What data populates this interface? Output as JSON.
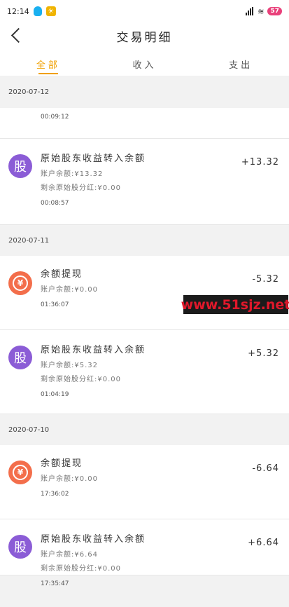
{
  "status": {
    "time": "12:14",
    "battery": "57"
  },
  "header": {
    "title": "交易明细"
  },
  "tabs": [
    {
      "label": "全部"
    },
    {
      "label": "收入"
    },
    {
      "label": "支出"
    }
  ],
  "groups": [
    {
      "date": "2020-07-12"
    },
    {
      "date": "2020-07-11"
    },
    {
      "date": "2020-07-10"
    }
  ],
  "records": [
    {
      "time": "00:09:12"
    },
    {
      "icon": "股",
      "title": "原始股东收益转入余额",
      "line1": "账户余额:¥13.32",
      "line2": "剩余原始股分红:¥0.00",
      "time": "00:08:57",
      "amount": "+13.32"
    },
    {
      "icon": "¥",
      "title": "余额提现",
      "line1": "账户余额:¥0.00",
      "time": "01:36:07",
      "amount": "-5.32"
    },
    {
      "icon": "股",
      "title": "原始股东收益转入余额",
      "line1": "账户余额:¥5.32",
      "line2": "剩余原始股分红:¥0.00",
      "time": "01:04:19",
      "amount": "+5.32"
    },
    {
      "icon": "¥",
      "title": "余额提现",
      "line1": "账户余额:¥0.00",
      "time": "17:36:02",
      "amount": "-6.64"
    },
    {
      "icon": "股",
      "title": "原始股东收益转入余额",
      "line1": "账户余额:¥6.64",
      "line2": "剩余原始股分红:¥0.00",
      "time": "17:35:47",
      "amount": "+6.64"
    }
  ],
  "watermark": "www.51sjz.net",
  "colors": {
    "accent": "#f0a000",
    "stock_icon": "#8b5cd6",
    "cash_icon": "#f36e4b"
  }
}
